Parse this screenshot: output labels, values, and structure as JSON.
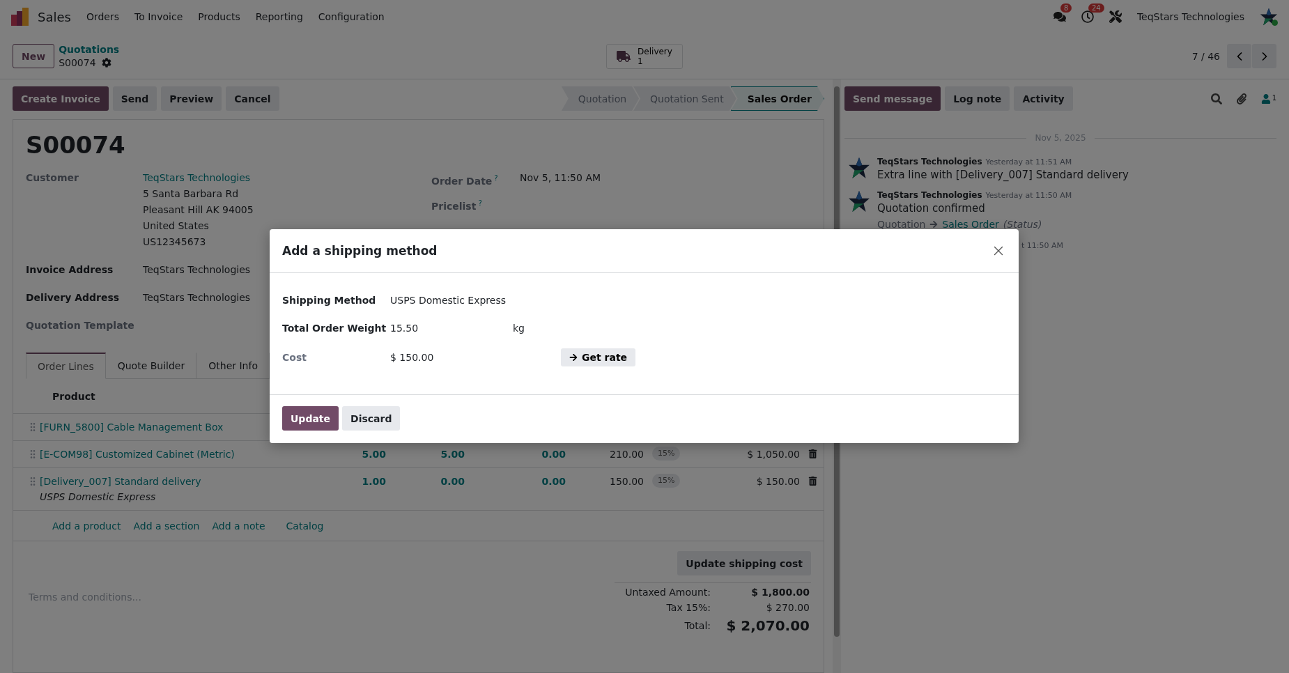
{
  "navbar": {
    "app": "Sales",
    "menu": [
      "Orders",
      "To Invoice",
      "Products",
      "Reporting",
      "Configuration"
    ],
    "messages_count": "8",
    "activities_count": "24",
    "company": "TeqStars Technologies"
  },
  "control_panel": {
    "new_button": "New",
    "breadcrumb": "Quotations",
    "record": "S00074",
    "smart_button": {
      "label": "Delivery",
      "value": "1"
    },
    "pager": "7 / 46"
  },
  "actions": [
    {
      "label": "Create Invoice",
      "primary": true
    },
    {
      "label": "Send",
      "primary": false
    },
    {
      "label": "Preview",
      "primary": false
    },
    {
      "label": "Cancel",
      "primary": false
    }
  ],
  "statusbar": [
    {
      "label": "Quotation",
      "selected": false
    },
    {
      "label": "Quotation Sent",
      "selected": false
    },
    {
      "label": "Sales Order",
      "selected": true
    }
  ],
  "form": {
    "name": "S00074",
    "left": [
      {
        "label": "Customer",
        "required": false,
        "value": "TeqStars Technologies",
        "link": true,
        "lines": [
          "5 Santa Barbara Rd",
          "Pleasant Hill AK 94005",
          "United States",
          "US12345673"
        ]
      },
      {
        "label": "Invoice Address",
        "required": true,
        "value": "TeqStars Technologies",
        "link": false
      },
      {
        "label": "Delivery Address",
        "required": true,
        "value": "TeqStars Technologies",
        "link": false
      },
      {
        "label": "Quotation Template",
        "required": false
      }
    ],
    "right": [
      {
        "label": "Order Date",
        "help": "?",
        "value": "Nov 5, 11:50 AM"
      },
      {
        "label": "Pricelist",
        "help": "?"
      }
    ]
  },
  "tabs": [
    {
      "label": "Order Lines",
      "selected": true
    },
    {
      "label": "Quote Builder",
      "selected": false
    },
    {
      "label": "Other Info",
      "selected": false
    }
  ],
  "order_lines": {
    "columns": [
      "Product"
    ],
    "rows": [
      {
        "product": "[FURN_5800] Cable Management Box"
      },
      {
        "product": "[E-COM98] Customized Cabinet (Metric)",
        "column_2": "5.00",
        "column_3": "5.00",
        "column_4": "0.00",
        "column_5": "210.00",
        "column_6": "15%",
        "column_7": "$ 1,050.00"
      },
      {
        "product": "[Delivery_007] Standard delivery",
        "description": "USPS Domestic Express",
        "column_2": "1.00",
        "column_3": "0.00",
        "column_4": "0.00",
        "column_5": "150.00",
        "column_6": "15%",
        "column_7": "$ 150.00"
      }
    ],
    "add_links": [
      "Add a product",
      "Add a section",
      "Add a note",
      "Catalog"
    ]
  },
  "update_shipping_button": "Update shipping cost",
  "terms_placeholder": "Terms and conditions...",
  "totals": [
    {
      "label": "Untaxed Amount:",
      "value": "$ 1,800.00",
      "kind": "subtotal"
    },
    {
      "label": "Tax 15%:",
      "value": "$ 270.00",
      "kind": "tax"
    },
    {
      "label": "Total:",
      "value": "$ 2,070.00",
      "kind": "total"
    }
  ],
  "chatter": {
    "buttons": [
      {
        "label": "Send message",
        "primary": true
      },
      {
        "label": "Log note",
        "primary": false
      },
      {
        "label": "Activity",
        "primary": false
      }
    ],
    "followers_count": "1",
    "date": "Nov 5, 2025",
    "messages": [
      {
        "kind": "message",
        "author": "TeqStars Technologies",
        "time": "Yesterday at 11:51 AM",
        "body": "Extra line with [Delivery_007] Standard delivery"
      },
      {
        "kind": "message",
        "author": "TeqStars Technologies",
        "time": "Yesterday at 11:50 AM",
        "body": "Quotation confirmed",
        "tracking": {
          "old": "Quotation",
          "new": "Sales Order",
          "field": "(Status)"
        }
      },
      {
        "kind": "fragment",
        "time": "t 11:50 AM"
      }
    ]
  },
  "dialog": {
    "title": "Add a shipping method",
    "fields": [
      {
        "label": "Shipping Method",
        "required": true,
        "value": "USPS Domestic Express"
      },
      {
        "label": "Total Order Weight",
        "required": true,
        "value": "15.50",
        "unit": "kg"
      },
      {
        "label": "Cost",
        "required": false,
        "value": "$ 150.00",
        "button": "Get rate"
      }
    ],
    "buttons": [
      {
        "label": "Update",
        "primary": true
      },
      {
        "label": "Discard",
        "primary": false
      }
    ]
  }
}
